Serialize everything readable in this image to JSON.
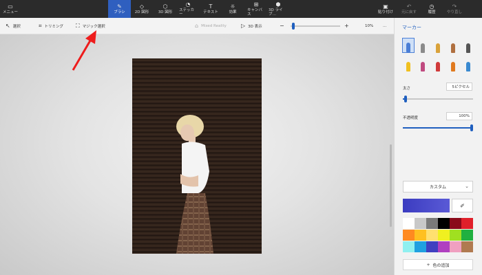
{
  "toolbar": {
    "menu": {
      "label": "メニュー",
      "icon": "folder-icon"
    },
    "tools": [
      {
        "label": "ブラシ",
        "icon": "brush-icon",
        "active": true
      },
      {
        "label": "2D 図形",
        "icon": "shapes-icon"
      },
      {
        "label": "3D 図形",
        "icon": "cube-icon"
      },
      {
        "label": "ステッカー",
        "icon": "sticker-icon"
      },
      {
        "label": "テキスト",
        "icon": "text-icon"
      },
      {
        "label": "効果",
        "icon": "sun-icon"
      },
      {
        "label": "キャンバス",
        "icon": "canvas-icon"
      },
      {
        "label": "3D ライブ…",
        "icon": "library-icon"
      }
    ],
    "right": [
      {
        "label": "貼り付け",
        "icon": "paste-icon"
      },
      {
        "label": "元に戻す",
        "icon": "undo-icon",
        "disabled": true
      },
      {
        "label": "履歴",
        "icon": "history-icon"
      },
      {
        "label": "やり直し",
        "icon": "redo-icon",
        "disabled": true
      }
    ]
  },
  "secondary": {
    "select": "選択",
    "crop": "トリミング",
    "magic_select": "マジック選択",
    "mixed_reality": "Mixed Reality",
    "view3d": "3D 表示",
    "zoom": "10%",
    "zoom_fraction": 0.03,
    "more": "…"
  },
  "panel": {
    "title": "マーカー",
    "thickness_label": "太さ",
    "thickness_value": "5ピクセル",
    "thickness_fraction": 0.02,
    "opacity_label": "不透明度",
    "opacity_value": "100%",
    "opacity_fraction": 1.0,
    "color_mode": "カスタム",
    "current_color": "#3b3cc0",
    "add_color": "色の追加",
    "brush_colors": [
      "#4a7ed6",
      "#8a8a8a",
      "#d9a23a",
      "#b07040",
      "#f0c020",
      "#c04a80",
      "#d03a3a",
      "#c09020",
      "#e07a20",
      "#3a8ad0"
    ],
    "swatches": [
      "#ffffff",
      "#c8c8c8",
      "#7a7a7a",
      "#000000",
      "#8a0a1a",
      "#e0202a",
      "#ff8a20",
      "#ffc020",
      "#ffe070",
      "#f0f020",
      "#a0e020",
      "#20b040",
      "#90f0f0",
      "#20a0e0",
      "#4040c0",
      "#b040c0",
      "#f0a0c0",
      "#b07a50"
    ]
  }
}
